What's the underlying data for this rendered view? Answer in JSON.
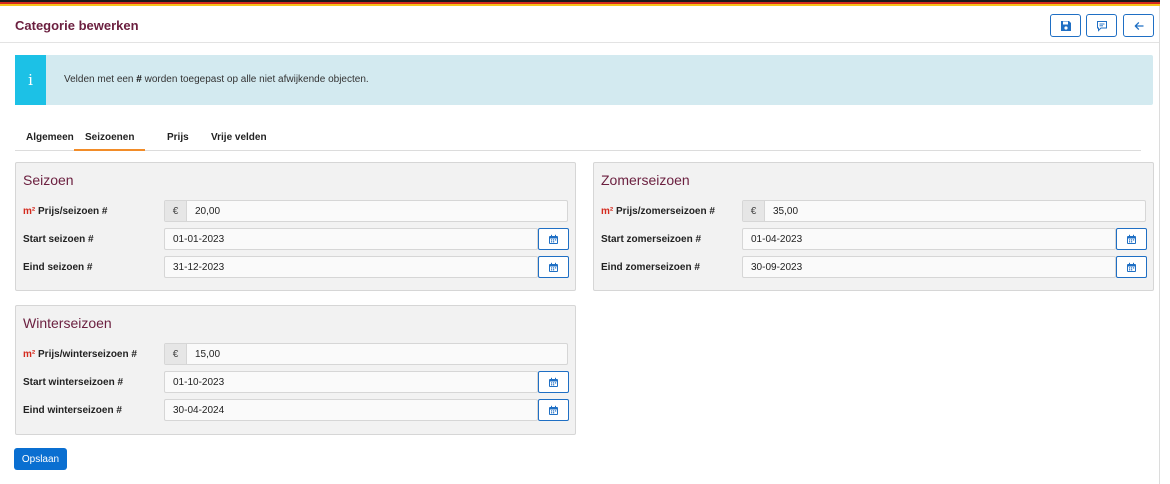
{
  "header": {
    "title": "Categorie bewerken",
    "buttons": [
      "save-icon",
      "comment-icon",
      "arrow-left-icon"
    ]
  },
  "info": {
    "icon": "i",
    "text_before": "Velden met een ",
    "text_bold": "#",
    "text_after": " worden toegepast op alle niet afwijkende objecten."
  },
  "tabs": [
    {
      "label": "Algemeen",
      "active": false
    },
    {
      "label": "Seizoenen",
      "active": true
    },
    {
      "label": "Prijs",
      "active": false
    },
    {
      "label": "Vrije velden",
      "active": false
    }
  ],
  "cards": {
    "seizoen": {
      "title": "Seizoen",
      "price_label_prefix": "m²",
      "price_label": "Prijs/seizoen #",
      "currency": "€",
      "price": "20,00",
      "start_label": "Start seizoen #",
      "start": "01-01-2023",
      "end_label": "Eind seizoen #",
      "end": "31-12-2023"
    },
    "zomer": {
      "title": "Zomerseizoen",
      "price_label_prefix": "m²",
      "price_label": "Prijs/zomerseizoen #",
      "currency": "€",
      "price": "35,00",
      "start_label": "Start zomerseizoen #",
      "start": "01-04-2023",
      "end_label": "Eind zomerseizoen #",
      "end": "30-09-2023"
    },
    "winter": {
      "title": "Winterseizoen",
      "price_label_prefix": "m²",
      "price_label": "Prijs/winterseizoen #",
      "currency": "€",
      "price": "15,00",
      "start_label": "Start winterseizoen #",
      "start": "01-10-2023",
      "end_label": "Eind winterseizoen #",
      "end": "30-04-2024"
    }
  },
  "footer": {
    "save_label": "Opslaan"
  },
  "colors": {
    "accent": "#1f6fc4",
    "title": "#6b1f3f",
    "tab_active": "#f28c28",
    "info_bg": "#d3eaf0",
    "info_icon": "#1cc1e6"
  }
}
